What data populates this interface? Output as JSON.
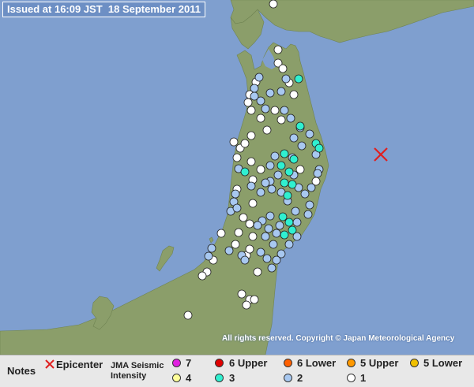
{
  "header": {
    "issued": "Issued at 16:09 JST  18 September 2011"
  },
  "copyright": "All rights reserved. Copyright © Japan Meteorological Agency",
  "colors": {
    "sea": "#7f9fcf",
    "land": "#8b9e6a",
    "epicenter": "#e02020",
    "intensity_1": "#ffffff",
    "intensity_2": "#a8c8f0",
    "intensity_3": "#30f0d0",
    "intensity_4": "#ffff99",
    "intensity_5_lower": "#f0c000",
    "intensity_5_upper": "#ff9900",
    "intensity_6_lower": "#ff6000",
    "intensity_6_upper": "#e00000",
    "intensity_7": "#e020e0"
  },
  "legend": {
    "notes": "Notes",
    "epicenter": "Epicenter",
    "scale_line1": "JMA Seismic",
    "scale_line2": "Intensity",
    "levels": {
      "i7": "7",
      "i6u": "6 Upper",
      "i6l": "6 Lower",
      "i5u": "5 Upper",
      "i5l": "5 Lower",
      "i4": "4",
      "i3": "3",
      "i2": "2",
      "i1": "1"
    }
  },
  "epicenter": {
    "icon": "red-x-icon"
  },
  "stations": {
    "intensity_1": [
      [
        346,
        5
      ],
      [
        352,
        63
      ],
      [
        352,
        80
      ],
      [
        324,
        104
      ],
      [
        316,
        120
      ],
      [
        314,
        130
      ],
      [
        318,
        140
      ],
      [
        330,
        150
      ],
      [
        348,
        140
      ],
      [
        356,
        152
      ],
      [
        338,
        165
      ],
      [
        296,
        180
      ],
      [
        304,
        188
      ],
      [
        300,
        200
      ],
      [
        318,
        172
      ],
      [
        310,
        182
      ],
      [
        318,
        205
      ],
      [
        330,
        215
      ],
      [
        320,
        228
      ],
      [
        300,
        240
      ],
      [
        380,
        215
      ],
      [
        400,
        230
      ],
      [
        320,
        258
      ],
      [
        308,
        276
      ],
      [
        316,
        284
      ],
      [
        302,
        295
      ],
      [
        298,
        310
      ],
      [
        280,
        296
      ],
      [
        270,
        330
      ],
      [
        262,
        345
      ],
      [
        256,
        350
      ],
      [
        320,
        300
      ],
      [
        312,
        324
      ],
      [
        326,
        345
      ],
      [
        306,
        373
      ],
      [
        316,
        380
      ],
      [
        312,
        387
      ],
      [
        322,
        380
      ],
      [
        238,
        400
      ],
      [
        316,
        316
      ],
      [
        366,
        105
      ],
      [
        372,
        120
      ],
      [
        358,
        87
      ]
    ],
    "intensity_2": [
      [
        362,
        100
      ],
      [
        342,
        118
      ],
      [
        330,
        128
      ],
      [
        336,
        138
      ],
      [
        360,
        140
      ],
      [
        368,
        150
      ],
      [
        380,
        162
      ],
      [
        372,
        175
      ],
      [
        382,
        185
      ],
      [
        370,
        200
      ],
      [
        392,
        170
      ],
      [
        400,
        196
      ],
      [
        404,
        215
      ],
      [
        394,
        238
      ],
      [
        402,
        220
      ],
      [
        372,
        222
      ],
      [
        378,
        238
      ],
      [
        386,
        246
      ],
      [
        392,
        260
      ],
      [
        390,
        272
      ],
      [
        374,
        268
      ],
      [
        364,
        255
      ],
      [
        342,
        230
      ],
      [
        352,
        222
      ],
      [
        344,
        240
      ],
      [
        356,
        244
      ],
      [
        336,
        232
      ],
      [
        330,
        244
      ],
      [
        318,
        236
      ],
      [
        298,
        246
      ],
      [
        292,
        268
      ],
      [
        296,
        256
      ],
      [
        300,
        264
      ],
      [
        342,
        274
      ],
      [
        332,
        280
      ],
      [
        326,
        286
      ],
      [
        340,
        290
      ],
      [
        336,
        300
      ],
      [
        346,
        310
      ],
      [
        350,
        296
      ],
      [
        354,
        286
      ],
      [
        376,
        282
      ],
      [
        376,
        300
      ],
      [
        366,
        310
      ],
      [
        356,
        322
      ],
      [
        350,
        330
      ],
      [
        344,
        340
      ],
      [
        338,
        328
      ],
      [
        330,
        320
      ],
      [
        306,
        324
      ],
      [
        310,
        330
      ],
      [
        290,
        318
      ],
      [
        268,
        315
      ],
      [
        264,
        325
      ],
      [
        302,
        214
      ],
      [
        342,
        210
      ],
      [
        348,
        198
      ],
      [
        322,
        122
      ],
      [
        328,
        98
      ],
      [
        356,
        116
      ],
      [
        322,
        112
      ]
    ],
    "intensity_3": [
      [
        378,
        100
      ],
      [
        380,
        160
      ],
      [
        400,
        182
      ],
      [
        404,
        188
      ],
      [
        360,
        195
      ],
      [
        372,
        202
      ],
      [
        356,
        210
      ],
      [
        366,
        218
      ],
      [
        360,
        232
      ],
      [
        370,
        234
      ],
      [
        364,
        248
      ],
      [
        310,
        218
      ],
      [
        358,
        275
      ],
      [
        366,
        282
      ],
      [
        370,
        292
      ],
      [
        360,
        298
      ]
    ]
  }
}
